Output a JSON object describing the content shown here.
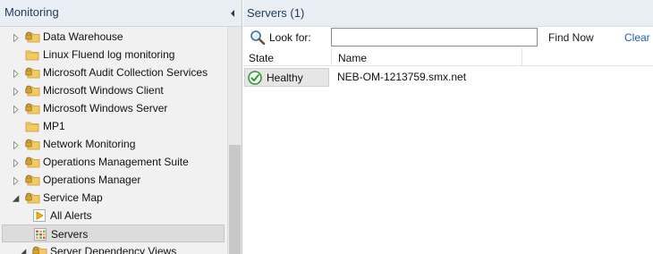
{
  "nav": {
    "title": "Monitoring",
    "items": [
      {
        "label": "Data Warehouse",
        "icon": "folder-lock-icon",
        "expander": "collapsed"
      },
      {
        "label": "Linux Fluend log monitoring",
        "icon": "folder-icon",
        "expander": "none"
      },
      {
        "label": "Microsoft Audit Collection Services",
        "icon": "folder-lock-icon",
        "expander": "collapsed"
      },
      {
        "label": "Microsoft Windows Client",
        "icon": "folder-lock-icon",
        "expander": "collapsed"
      },
      {
        "label": "Microsoft Windows Server",
        "icon": "folder-lock-icon",
        "expander": "collapsed"
      },
      {
        "label": "MP1",
        "icon": "folder-icon",
        "expander": "none"
      },
      {
        "label": "Network Monitoring",
        "icon": "folder-lock-icon",
        "expander": "collapsed"
      },
      {
        "label": "Operations Management Suite",
        "icon": "folder-lock-icon",
        "expander": "collapsed"
      },
      {
        "label": "Operations Manager",
        "icon": "folder-lock-icon",
        "expander": "collapsed"
      },
      {
        "label": "Service Map",
        "icon": "folder-lock-icon",
        "expander": "expanded"
      },
      {
        "label": "All Alerts",
        "icon": "alert-view-icon",
        "expander": "none"
      },
      {
        "label": "Servers",
        "icon": "state-view-icon",
        "expander": "none",
        "selected": true
      },
      {
        "label": "Server Dependency Views",
        "icon": "folder-lock-icon",
        "expander": "expanded"
      }
    ]
  },
  "content": {
    "title": "Servers (1)",
    "search": {
      "label": "Look for:",
      "value": "",
      "find_now_label": "Find Now",
      "clear_label": "Clear"
    },
    "columns": [
      "State",
      "Name"
    ],
    "rows": [
      {
        "state": "Healthy",
        "state_icon": "healthy-check-icon",
        "name": "NEB-OM-1213759.smx.net"
      }
    ]
  },
  "colors": {
    "header_bg": "#e9eef4",
    "header_text": "#1e395b",
    "healthy": "#2e9b2e",
    "link": "#1f5fa9",
    "folder": "#f0c75e"
  }
}
